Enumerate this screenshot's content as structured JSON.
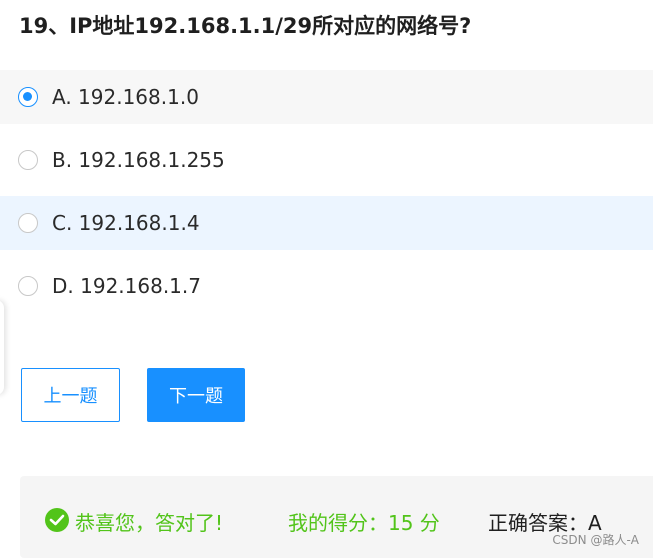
{
  "question": {
    "title": "19、IP地址192.168.1.1/29所对应的网络号?"
  },
  "options": [
    {
      "label": "A. 192.168.1.0",
      "selected": true
    },
    {
      "label": "B. 192.168.1.255",
      "selected": false
    },
    {
      "label": "C. 192.168.1.4",
      "selected": false
    },
    {
      "label": "D. 192.168.1.7",
      "selected": false
    }
  ],
  "buttons": {
    "prev_label": "上一题",
    "next_label": "下一题"
  },
  "result": {
    "icon": "check-circle-icon",
    "congrats_text": "恭喜您，答对了!",
    "score_text": "我的得分：15 分",
    "answer_text": "正确答案：A"
  },
  "watermark": "CSDN @路人-A",
  "colors": {
    "accent": "#1890ff",
    "success": "#52c41a",
    "hover_row": "#ecf5ff",
    "selected_row": "#f7f7f7"
  }
}
